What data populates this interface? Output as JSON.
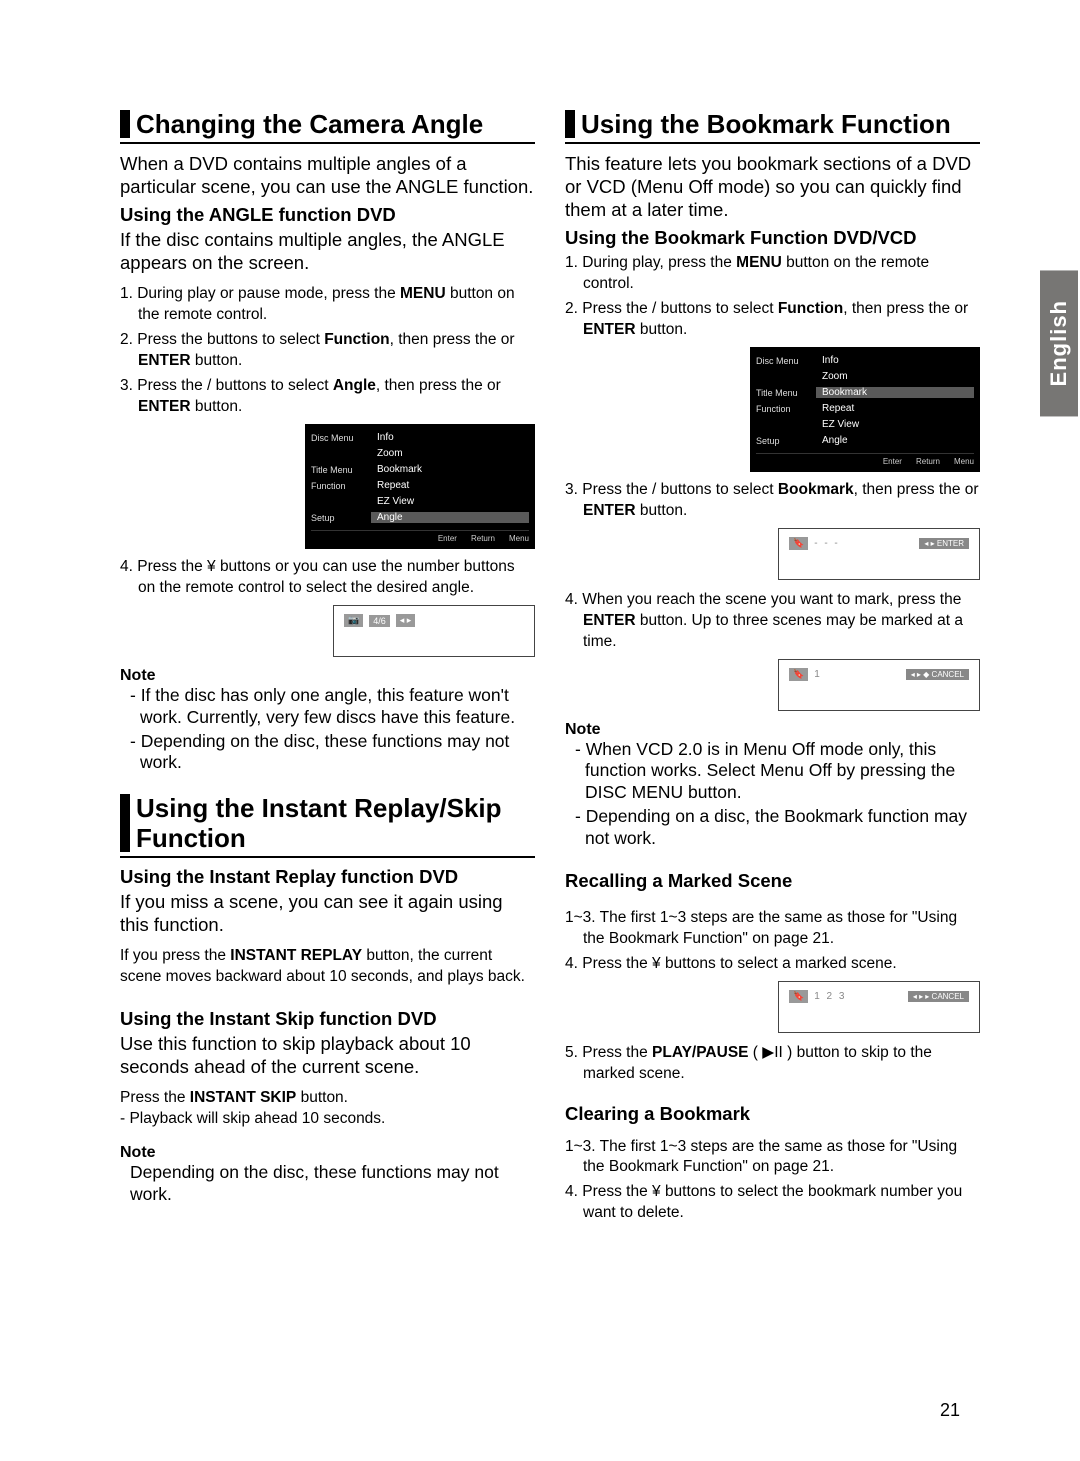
{
  "sideTab": "English",
  "pageNumber": "21",
  "left": {
    "sec1": {
      "title": "Changing the Camera Angle",
      "intro": "When a DVD contains multiple angles of a particular scene, you can use the ANGLE function.",
      "sub1": "Using the ANGLE function DVD",
      "sub1_body": "If the disc contains multiple angles, the ANGLE appears on the screen.",
      "steps": {
        "s1a": "1. During play or pause mode, press the ",
        "s1b": "MENU",
        "s1c": " button on the remote control.",
        "s2a": "2. Press the        buttons to select ",
        "s2b": "Function",
        "s2c": ", then press the     or ",
        "s2d": "ENTER",
        "s2e": "  button.",
        "s3a": "3. Press the     /     buttons to select ",
        "s3b": "Angle",
        "s3c": ", then press the      or ",
        "s3d": "ENTER",
        "s3e": " button.",
        "s4a": "4. Press the  ¥        buttons or you can use the number buttons on the remote control to select the desired angle."
      },
      "note_head": "Note",
      "note1": "- If the disc has only one angle, this feature won't work. Currently, very few discs have this feature.",
      "note2": "- Depending on the disc, these functions may not work."
    },
    "sec2": {
      "title": "Using the Instant Replay/Skip Function",
      "sub1": "Using the Instant Replay function DVD",
      "sub1_body": "If you miss a scene, you can see it again using this function.",
      "sub1_small_a": "If you press the ",
      "sub1_small_b": "INSTANT REPLAY",
      "sub1_small_c": " button, the current scene moves backward about 10 seconds, and plays back.",
      "sub2": "Using the Instant Skip function DVD",
      "sub2_body": "Use this function to skip playback about 10 seconds ahead of the current scene.",
      "sub2_small_a": "Press the ",
      "sub2_small_b": "INSTANT SKIP",
      "sub2_small_c": " button.",
      "sub2_small_d": "- Playback will skip ahead 10 seconds.",
      "note_head": "Note",
      "note1": "Depending on the disc, these functions may not work."
    }
  },
  "right": {
    "sec1": {
      "title": "Using the Bookmark Function",
      "intro": "This feature lets you bookmark sections of a DVD or VCD (Menu Off mode) so you can quickly find them at a later time.",
      "sub1": "Using the Bookmark Function DVD/VCD",
      "steps": {
        "s1a": "1. During play, press the ",
        "s1b": "MENU",
        "s1c": " button on the remote control.",
        "s2a": "2. Press the     /     buttons to select ",
        "s2b": "Function",
        "s2c": ", then  press the     or ",
        "s2d": "ENTER",
        "s2e": " button.",
        "s3a": "3. Press the     /     buttons to select ",
        "s3b": "Bookmark",
        "s3c": ", then press the      or ",
        "s3d": "ENTER",
        "s3e": " button.",
        "s4a": "4. When you reach the scene you want to mark, press the ",
        "s4b": "ENTER",
        "s4c": " button. Up to three scenes may be marked at a time."
      },
      "note_head": "Note",
      "note1": "-  When VCD 2.0 is in Menu Off mode only, this function works. Select Menu Off by pressing the DISC MENU button.",
      "note2": "-  Depending on a disc, the Bookmark function may not work.",
      "sub2": "Recalling a Marked Scene",
      "recall": {
        "s13": "1~3. The first 1~3 steps are the same as those for \"Using the Bookmark Function\" on page 21.",
        "s4": "4.  Press the  ¥        buttons to select a marked scene.",
        "s5a": "5. Press the ",
        "s5b": "PLAY/PAUSE",
        "s5c": " (  ▶II  ) button to skip to the marked scene."
      },
      "sub3": "Clearing a Bookmark",
      "clear": {
        "s13": "1~3. The first 1~3 steps are the same as those for  \"Using the Bookmark Function\" on page 21.",
        "s4": "4.  Press the  ¥        buttons to select the bookmark number you want to delete."
      }
    }
  },
  "osd": {
    "left": {
      "l1": "Disc Menu",
      "l2": "Title Menu",
      "l3": "Function",
      "l4": "Setup"
    },
    "right": {
      "r1": "Info",
      "r2": "Zoom",
      "r3": "Bookmark",
      "r4": "Repeat",
      "r5": "EZ View",
      "r6": "Angle"
    },
    "footer": {
      "f1": "Enter",
      "f2": "Return",
      "f3": "Menu"
    },
    "angleBar": "4/6",
    "bookmarkBar": {
      "dash": "-  -  -",
      "btn1": "◂ ▸  ENTER",
      "one": "1",
      "btn2": "◂ ▸ ◆ CANCEL",
      "nums": "1  2  3",
      "btn3": "◂ ▸ ▸ CANCEL"
    }
  }
}
